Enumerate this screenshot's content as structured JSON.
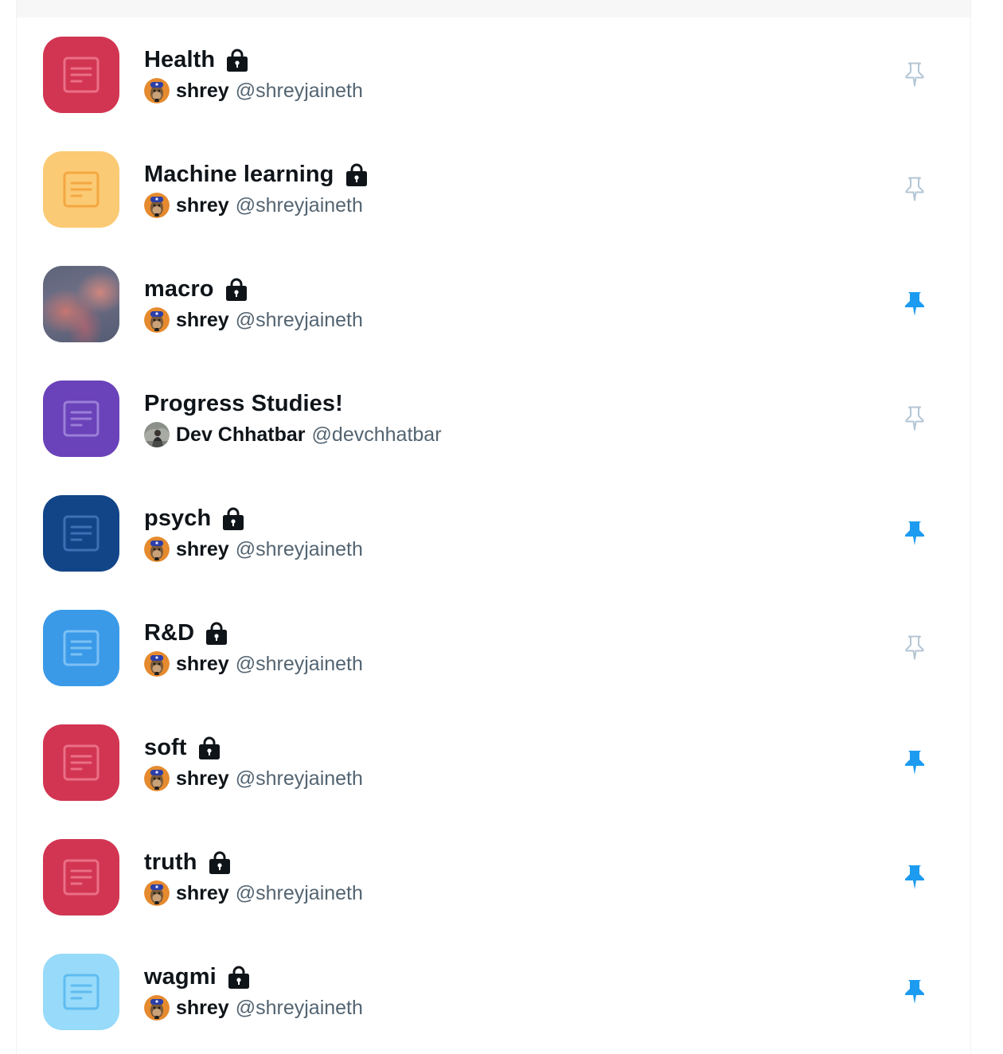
{
  "lists": [
    {
      "name": "Health",
      "private": true,
      "tile": {
        "kind": "icon",
        "bg": "#d23552",
        "fg": "#ea6f86"
      },
      "owner": {
        "name": "shrey",
        "handle": "@shreyjaineth",
        "avatar": "ape-avatar"
      },
      "pinned": false
    },
    {
      "name": "Machine learning",
      "private": true,
      "tile": {
        "kind": "icon",
        "bg": "#fbca74",
        "fg": "#f5a741"
      },
      "owner": {
        "name": "shrey",
        "handle": "@shreyjaineth",
        "avatar": "ape-avatar"
      },
      "pinned": false
    },
    {
      "name": "macro",
      "private": true,
      "tile": {
        "kind": "photo",
        "bg": "#5d6479",
        "fg": "#d6786e"
      },
      "owner": {
        "name": "shrey",
        "handle": "@shreyjaineth",
        "avatar": "ape-avatar"
      },
      "pinned": true
    },
    {
      "name": "Progress Studies!",
      "private": false,
      "tile": {
        "kind": "icon",
        "bg": "#6a42b9",
        "fg": "#9b7fd8"
      },
      "owner": {
        "name": "Dev Chhatbar",
        "handle": "@devchhatbar",
        "avatar": "photo-avatar"
      },
      "pinned": false
    },
    {
      "name": "psych",
      "private": true,
      "tile": {
        "kind": "icon",
        "bg": "#124588",
        "fg": "#3c6fb3"
      },
      "owner": {
        "name": "shrey",
        "handle": "@shreyjaineth",
        "avatar": "ape-avatar"
      },
      "pinned": true
    },
    {
      "name": "R&D",
      "private": true,
      "tile": {
        "kind": "icon",
        "bg": "#3a9ae8",
        "fg": "#7cc0f5"
      },
      "owner": {
        "name": "shrey",
        "handle": "@shreyjaineth",
        "avatar": "ape-avatar"
      },
      "pinned": false
    },
    {
      "name": "soft",
      "private": true,
      "tile": {
        "kind": "icon",
        "bg": "#d23552",
        "fg": "#ea6f86"
      },
      "owner": {
        "name": "shrey",
        "handle": "@shreyjaineth",
        "avatar": "ape-avatar"
      },
      "pinned": true
    },
    {
      "name": "truth",
      "private": true,
      "tile": {
        "kind": "icon",
        "bg": "#d23552",
        "fg": "#ea6f86"
      },
      "owner": {
        "name": "shrey",
        "handle": "@shreyjaineth",
        "avatar": "ape-avatar"
      },
      "pinned": true
    },
    {
      "name": "wagmi",
      "private": true,
      "tile": {
        "kind": "icon",
        "bg": "#97daf9",
        "fg": "#5fbcf0"
      },
      "owner": {
        "name": "shrey",
        "handle": "@shreyjaineth",
        "avatar": "ape-avatar"
      },
      "pinned": true
    }
  ],
  "colors": {
    "pin_active": "#1d9bf0",
    "pin_inactive": "#b4c6d4",
    "text_primary": "#0f1419",
    "text_secondary": "#536471"
  }
}
